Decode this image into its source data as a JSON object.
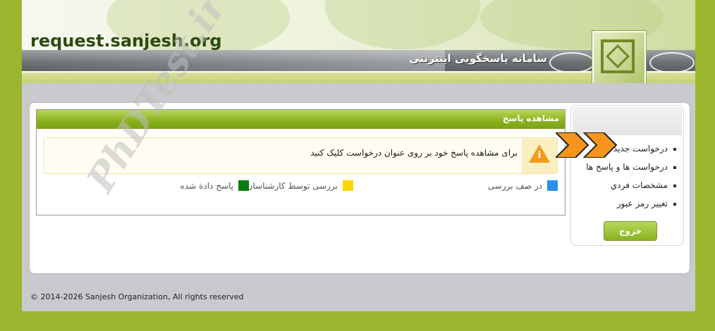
{
  "header": {
    "site_url": "request.sanjesh.org",
    "system_title": "سامانه پاسخگویی اینترنتی",
    "logo_icon": "sanjesh-logo"
  },
  "content": {
    "title": "مشاهده پاسخ",
    "info_text": "برای مشاهده پاسخ خود بر روی عنوان درخواست کلیک کنید",
    "info_icon": "warning-info-icon",
    "legend": [
      {
        "label": "در صف بررسی",
        "color": "#2b8fe8"
      },
      {
        "label": "بررسی توسط کارشناسان",
        "color": "#ffd400"
      },
      {
        "label": "پاسخ دادة شده",
        "color": "#0a7d12"
      }
    ]
  },
  "sidebar": {
    "items": [
      {
        "label": "درخواست جديد"
      },
      {
        "label": "درخواست ها و پاسخ ها"
      },
      {
        "label": "مشخصات فردي"
      },
      {
        "label": "تغيير رمز عبور"
      }
    ],
    "logout_label": "خروج"
  },
  "watermark": "PhDTest.ir",
  "footer": {
    "copyright": "© 2014-2026 Sanjesh Organization, All rights reserved"
  },
  "colors": {
    "outer_bg": "#9bb52f",
    "accent_green": "#8cb320",
    "arrow_orange": "#f7941d"
  }
}
